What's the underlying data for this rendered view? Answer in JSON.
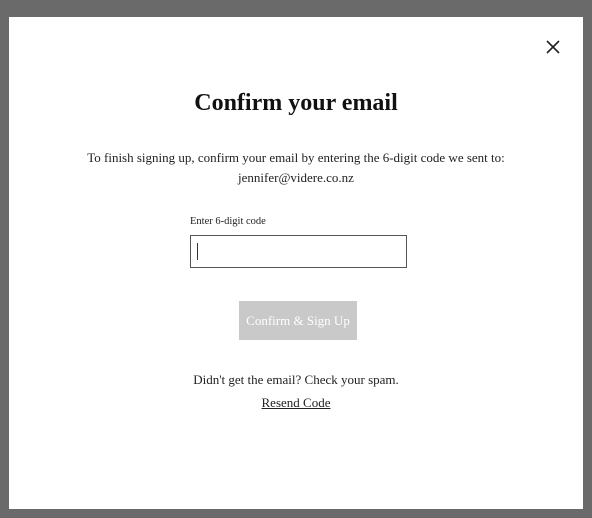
{
  "modal": {
    "title": "Confirm your email",
    "instruction_line1": "To finish signing up, confirm your email by entering the 6-digit code we sent to:",
    "email": "jennifer@videre.co.nz",
    "code_label": "Enter 6-digit code",
    "code_value": "",
    "confirm_button_label": "Confirm & Sign Up",
    "spam_note": "Didn't get the email? Check your spam.",
    "resend_link_label": "Resend Code",
    "close_icon": "close-icon"
  },
  "colors": {
    "backdrop": "#6a6a6a",
    "modal_bg": "#ffffff",
    "disabled_button": "#c9c9c9",
    "text": "#222222"
  }
}
